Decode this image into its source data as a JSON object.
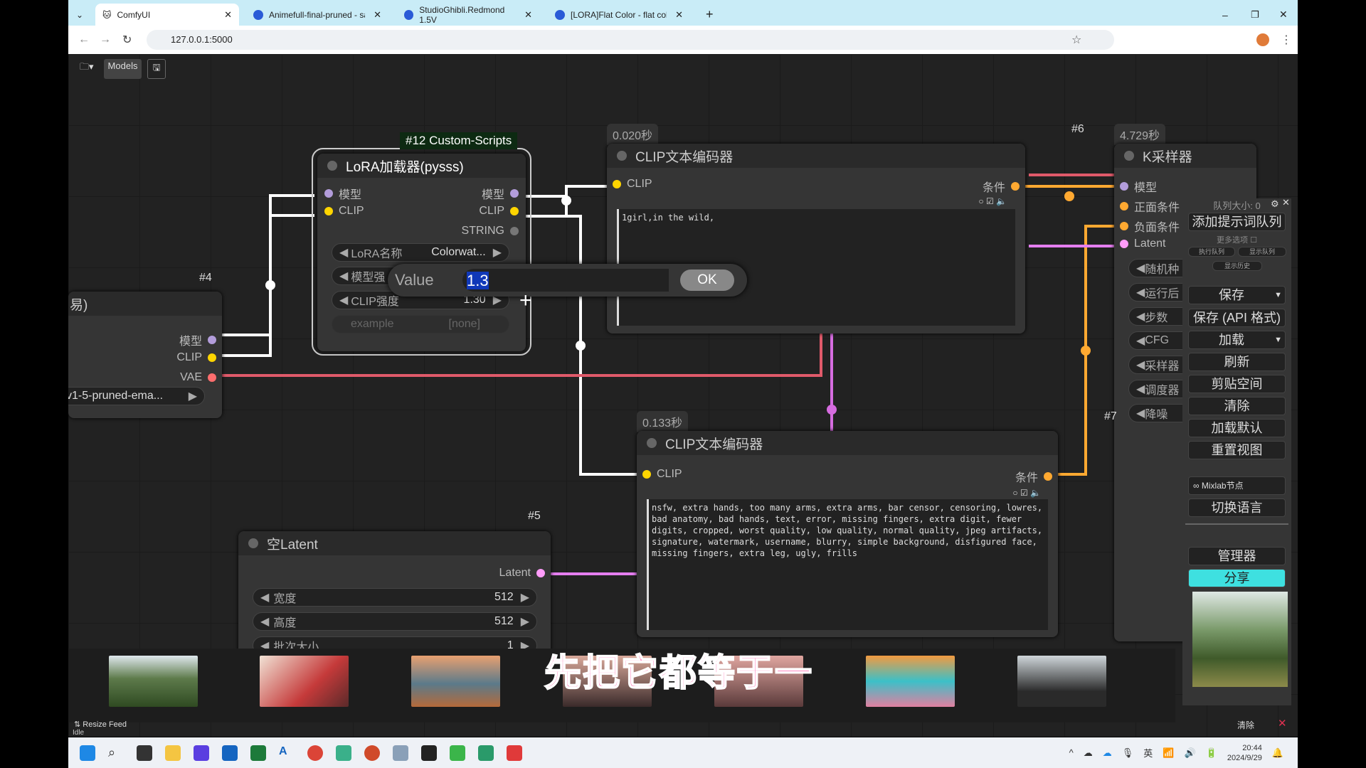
{
  "browser": {
    "tabs": [
      {
        "label": "ComfyUI",
        "active": true
      },
      {
        "label": "Animefull-final-pruned - safe"
      },
      {
        "label": "StudioGhibli.Redmond 1.5V"
      },
      {
        "label": "[LORA]Flat Color - flat color"
      }
    ],
    "new_tab": "+",
    "url": "127.0.0.1:5000",
    "window_controls": [
      "–",
      "❐",
      "✕"
    ]
  },
  "toolbar": {
    "folder": "▾",
    "models": "Models",
    "save_icon": "save-icon"
  },
  "nodes": {
    "lora": {
      "group": "#12 Custom-Scripts",
      "title": "LoRA加载器(pysss)",
      "in_model": "模型",
      "in_clip": "CLIP",
      "out_model": "模型",
      "out_clip": "CLIP",
      "out_string": "STRING",
      "lora_name_label": "LoRA名称",
      "lora_name_value": "Colorwat...",
      "model_strength_label": "模型强",
      "clip_strength_label": "CLIP强度",
      "clip_strength_value": "1.30",
      "example_label": "example",
      "example_value": "[none]"
    },
    "ckpt": {
      "id": "#4",
      "title_fragment": "易)",
      "out_model": "模型",
      "out_clip": "CLIP",
      "out_vae": "VAE",
      "ckpt_value": "v1-5-pruned-ema..."
    },
    "clip6": {
      "id": "#6",
      "time": "0.020秒",
      "title": "CLIP文本编码器",
      "in_clip": "CLIP",
      "out_cond": "条件",
      "text": "1girl,in the wild,"
    },
    "clip7": {
      "id": "#7",
      "time": "0.133秒",
      "title": "CLIP文本编码器",
      "in_clip": "CLIP",
      "out_cond": "条件",
      "text": "nsfw, extra hands, too many arms, extra arms, bar censor, censoring, lowres, bad anatomy, bad hands, text, error, missing fingers, extra digit, fewer digits, cropped, worst quality, low quality, normal quality, jpeg artifacts, signature, watermark, username, blurry, simple background, disfigured face, missing fingers, extra leg, ugly, frills"
    },
    "latent": {
      "id": "#5",
      "title": "空Latent",
      "out_latent": "Latent",
      "width_label": "宽度",
      "width_value": "512",
      "height_label": "高度",
      "height_value": "512",
      "batch_label": "批次大小",
      "batch_value": "1"
    },
    "ksampler": {
      "time": "4.729秒",
      "title": "K采样器",
      "inputs": [
        "模型",
        "正面条件",
        "负面条件",
        "Latent"
      ],
      "widgets": [
        "随机种",
        "运行后",
        "步数",
        "CFG",
        "采样器",
        "调度器",
        "降噪"
      ]
    }
  },
  "value_dialog": {
    "label": "Value",
    "value": "1.3",
    "ok": "OK"
  },
  "menu": {
    "queue_size": "队列大小: 0",
    "queue_prompt": "添加提示词队列",
    "more_options": "更多选项",
    "exec_queue": "执行队列",
    "show_queue": "显示队列",
    "show_history": "显示历史",
    "save": "保存",
    "save_api": "保存 (API 格式)",
    "load": "加载",
    "refresh": "刷新",
    "clipspace": "剪贴空间",
    "clear": "清除",
    "load_default": "加载默认",
    "reset_view": "重置视图",
    "mixlab": "Mixlab节点",
    "switch_lang": "切换语言",
    "manager": "管理器",
    "share": "分享"
  },
  "feed": {
    "resize": "Resize Feed",
    "clear": "清除",
    "status": "Idle"
  },
  "subtitle": "先把它都等于一",
  "taskbar": {
    "lang": "英",
    "time": "20:44",
    "date": "2024/9/29"
  },
  "colors": {
    "clip": "#ffd500",
    "model": "#b39ddb",
    "cond": "#ffa931",
    "latent": "#ff9cf9",
    "vae": "#ff6e6e",
    "share": "#3ee0e0"
  }
}
